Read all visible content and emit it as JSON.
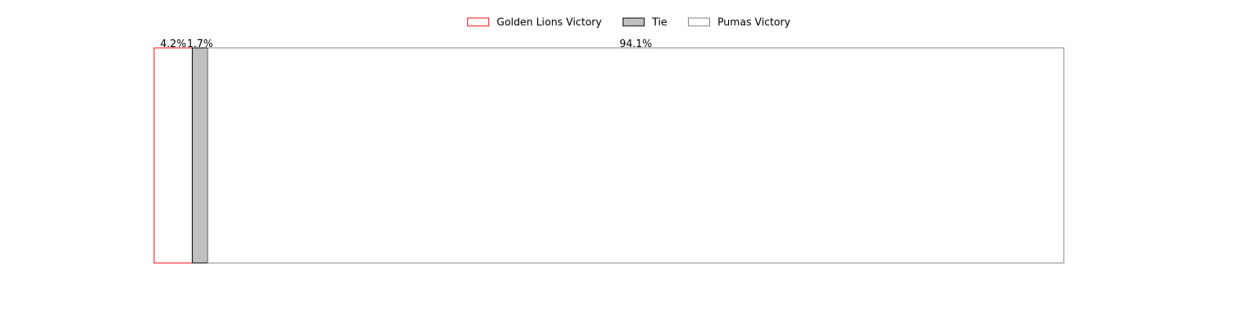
{
  "chart_data": {
    "type": "bar",
    "orientation": "horizontal-stacked",
    "x_range": [
      0,
      100
    ],
    "grid": false,
    "axes_visible": false,
    "legend_placement": "top-center",
    "series": [
      {
        "name": "Golden Lions Victory",
        "value": 4.2,
        "label": "4.2%",
        "fill": "#ffffff",
        "edge": "#ff0000"
      },
      {
        "name": "Tie",
        "value": 1.7,
        "label": "1.7%",
        "fill": "#c0c0c0",
        "edge": "#000000"
      },
      {
        "name": "Pumas Victory",
        "value": 94.1,
        "label": "94.1%",
        "fill": "#ffffff",
        "edge": "#808080"
      }
    ]
  }
}
